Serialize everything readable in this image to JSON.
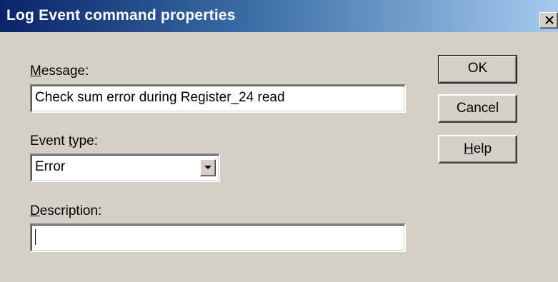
{
  "window": {
    "title": "Log Event command properties",
    "close_glyph": "×"
  },
  "message": {
    "label_accel": "M",
    "label_rest": "essage:",
    "value": "Check sum error during Register_24 read"
  },
  "event_type": {
    "label_pre": "Event ",
    "label_accel": "t",
    "label_rest": "ype:",
    "selected": "Error"
  },
  "description": {
    "label_accel": "D",
    "label_rest": "escription:",
    "value": ""
  },
  "buttons": {
    "ok": "OK",
    "cancel": "Cancel",
    "help_accel": "H",
    "help_rest": "elp"
  },
  "icons": {
    "close": "close-icon",
    "dropdown": "chevron-down-icon"
  }
}
